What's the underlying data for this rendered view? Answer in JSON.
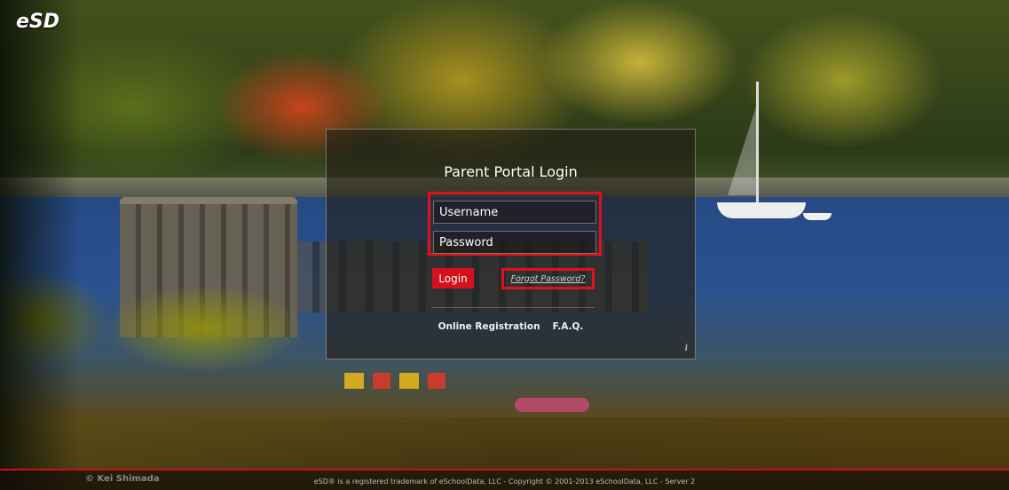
{
  "brand": {
    "logo_text": "eSD"
  },
  "login": {
    "title": "Parent Portal Login",
    "username_placeholder": "Username",
    "password_placeholder": "Password",
    "login_label": "Login",
    "forgot_label": "Forgot Password?"
  },
  "links": {
    "online_registration": "Online Registration",
    "faq": "F.A.Q.",
    "info": "i"
  },
  "footer": {
    "credit": "© Kei Shimada",
    "copyright": "eSD® is a registered trademark of eSchoolData, LLC - Copyright © 2001-2013 eSchoolData, LLC - Server 2"
  },
  "colors": {
    "accent": "#d5111d",
    "highlight_box": "#e0111c"
  }
}
